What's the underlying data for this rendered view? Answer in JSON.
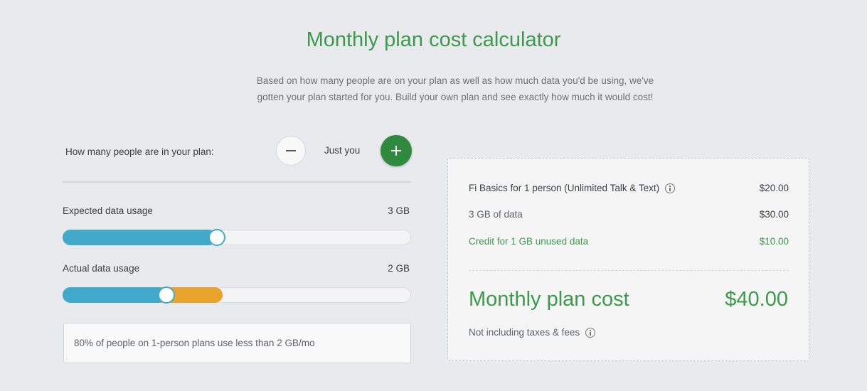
{
  "header": {
    "title": "Monthly plan cost calculator",
    "subtitle_line1": "Based on how many people are on your plan as well as how much data you'd be using, we've",
    "subtitle_line2": "gotten your plan started for you. Build your own plan and see exactly how much it would cost!"
  },
  "people": {
    "label": "How many people are in your plan:",
    "value": "Just you",
    "minus_icon": "minus-icon",
    "plus_icon": "plus-icon"
  },
  "expected_usage": {
    "label": "Expected data usage",
    "value": "3 GB",
    "fill_fraction": 0.44
  },
  "actual_usage": {
    "label": "Actual data usage",
    "value": "2 GB",
    "blue_fraction": 0.295,
    "orange_fraction": 0.46
  },
  "tip": "80% of people on 1-person plans use less than  2 GB/mo",
  "summary": {
    "items": [
      {
        "label": "Fi Basics for 1 person (Unlimited Talk & Text)",
        "amount": "$20.00",
        "icon": "info-icon"
      },
      {
        "label": "3 GB of data",
        "amount": "$30.00"
      },
      {
        "label": "Credit for 1 GB unused data",
        "amount": "$10.00"
      }
    ],
    "total_label": "Monthly plan cost",
    "total_amount": "$40.00",
    "note": "Not including taxes & fees"
  },
  "colors": {
    "accent_green": "#3d9a4c",
    "button_green": "#2f8a3e",
    "data_blue": "#41a9c9",
    "data_orange": "#e7a32c",
    "background": "#e8eaed"
  }
}
